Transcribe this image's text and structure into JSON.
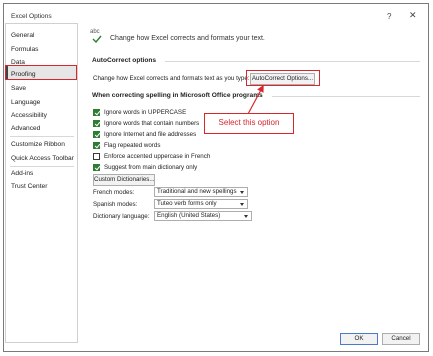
{
  "window": {
    "title": "Excel Options",
    "help_glyph": "?",
    "close_glyph": "✕"
  },
  "sidebar": {
    "items": [
      {
        "label": "General"
      },
      {
        "label": "Formulas"
      },
      {
        "label": "Data"
      },
      {
        "label": "Proofing"
      },
      {
        "label": "Save"
      },
      {
        "label": "Language"
      },
      {
        "label": "Accessibility"
      },
      {
        "label": "Advanced"
      },
      {
        "label": "Customize Ribbon"
      },
      {
        "label": "Quick Access Toolbar"
      },
      {
        "label": "Add-ins"
      },
      {
        "label": "Trust Center"
      }
    ],
    "selected": "Proofing"
  },
  "header": {
    "icon_text": "abc",
    "description": "Change how Excel corrects and formats your text."
  },
  "autocorrect": {
    "section_title": "AutoCorrect options",
    "label": "Change how Excel corrects and formats text as you type:",
    "button_label": "AutoCorrect Options..."
  },
  "annotation": {
    "callout_text": "Select this option",
    "highlight_color": "#d7262c"
  },
  "spelling": {
    "section_title": "When correcting spelling in Microsoft Office programs",
    "options": [
      {
        "label": "Ignore words in UPPERCASE",
        "checked": true
      },
      {
        "label": "Ignore words that contain numbers",
        "checked": true
      },
      {
        "label": "Ignore Internet and file addresses",
        "checked": true
      },
      {
        "label": "Flag repeated words",
        "checked": true
      },
      {
        "label": "Enforce accented uppercase in French",
        "checked": false
      },
      {
        "label": "Suggest from main dictionary only",
        "checked": true
      }
    ],
    "custom_dictionaries_label": "Custom Dictionaries...",
    "french_modes_label": "French modes:",
    "french_modes_value": "Traditional and new spellings",
    "spanish_modes_label": "Spanish modes:",
    "spanish_modes_value": "Tuteo verb forms only",
    "dictionary_language_label": "Dictionary language:",
    "dictionary_language_value": "English (United States)"
  },
  "footer": {
    "ok_label": "OK",
    "cancel_label": "Cancel"
  },
  "colors": {
    "checkbox_checked": "#2e7d32",
    "ok_border": "#4a7bc8"
  }
}
